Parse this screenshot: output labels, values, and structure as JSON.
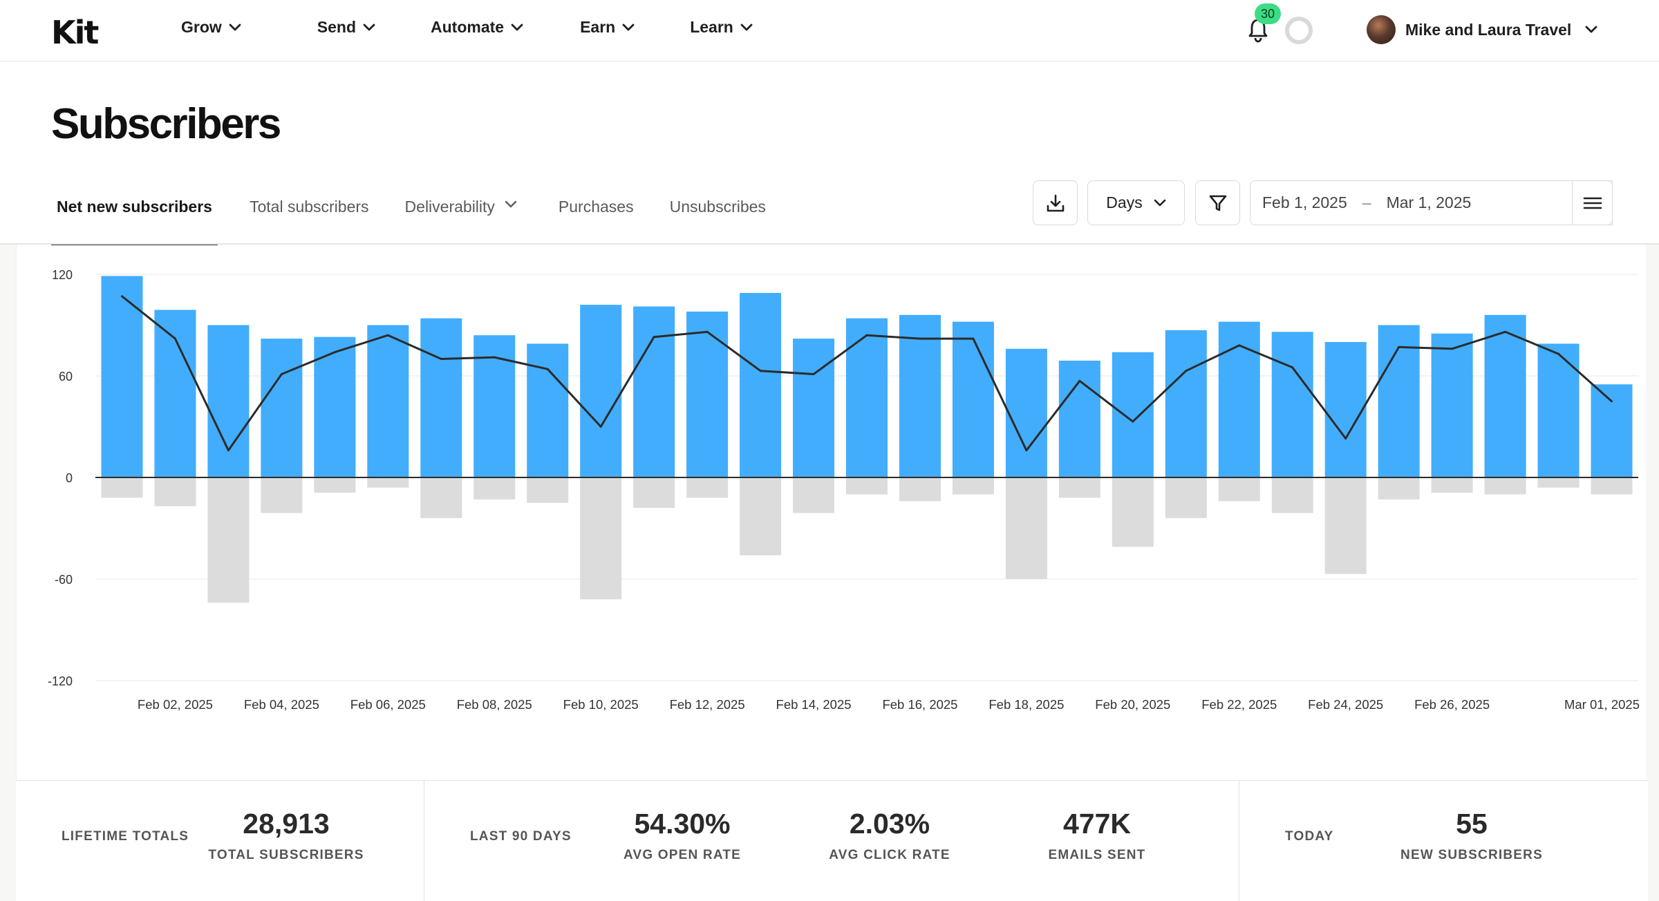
{
  "nav": {
    "logo": "Kit",
    "menu": [
      {
        "label": "Grow"
      },
      {
        "label": "Send"
      },
      {
        "label": "Automate"
      },
      {
        "label": "Earn"
      },
      {
        "label": "Learn"
      }
    ],
    "notification_count": "30",
    "account_name": "Mike and Laura Travel"
  },
  "page": {
    "title": "Subscribers",
    "tabs": [
      {
        "label": "Net new subscribers",
        "active": true
      },
      {
        "label": "Total subscribers"
      },
      {
        "label": "Deliverability",
        "dropdown": true
      },
      {
        "label": "Purchases"
      },
      {
        "label": "Unsubscribes"
      }
    ]
  },
  "toolbar": {
    "interval": "Days",
    "date_start": "Feb 1, 2025",
    "date_separator": "–",
    "date_end": "Mar 1, 2025"
  },
  "chart_data": {
    "type": "bar",
    "y_ticks": [
      120,
      60,
      0,
      -60,
      -120
    ],
    "ylim": [
      -120,
      120
    ],
    "grid": true,
    "x_tick_labels": [
      "Feb 02, 2025",
      "Feb 04, 2025",
      "Feb 06, 2025",
      "Feb 08, 2025",
      "Feb 10, 2025",
      "Feb 12, 2025",
      "Feb 14, 2025",
      "Feb 16, 2025",
      "Feb 18, 2025",
      "Feb 20, 2025",
      "Feb 22, 2025",
      "Feb 24, 2025",
      "Feb 26, 2025",
      "Mar 01, 2025"
    ],
    "categories": [
      "Feb 01, 2025",
      "Feb 02, 2025",
      "Feb 03, 2025",
      "Feb 04, 2025",
      "Feb 05, 2025",
      "Feb 06, 2025",
      "Feb 07, 2025",
      "Feb 08, 2025",
      "Feb 09, 2025",
      "Feb 10, 2025",
      "Feb 11, 2025",
      "Feb 12, 2025",
      "Feb 13, 2025",
      "Feb 14, 2025",
      "Feb 15, 2025",
      "Feb 16, 2025",
      "Feb 17, 2025",
      "Feb 18, 2025",
      "Feb 19, 2025",
      "Feb 20, 2025",
      "Feb 21, 2025",
      "Feb 22, 2025",
      "Feb 23, 2025",
      "Feb 24, 2025",
      "Feb 25, 2025",
      "Feb 26, 2025",
      "Feb 27, 2025",
      "Feb 28, 2025",
      "Mar 01, 2025"
    ],
    "series": [
      {
        "color": "#42adfc",
        "values": [
          119,
          99,
          90,
          82,
          83,
          90,
          94,
          84,
          79,
          102,
          101,
          98,
          109,
          82,
          94,
          96,
          92,
          76,
          69,
          74,
          87,
          92,
          86,
          80,
          90,
          85,
          96,
          79,
          55
        ]
      },
      {
        "color": "#dcdcdc",
        "values": [
          -12,
          -17,
          -74,
          -21,
          -9,
          -6,
          -24,
          -13,
          -15,
          -72,
          -18,
          -12,
          -46,
          -21,
          -10,
          -14,
          -10,
          -60,
          -12,
          -41,
          -24,
          -14,
          -21,
          -57,
          -13,
          -9,
          -10,
          -6,
          -10
        ]
      },
      {
        "color": "#2b2b2b",
        "values": [
          107,
          82,
          16,
          61,
          74,
          84,
          70,
          71,
          64,
          30,
          83,
          86,
          63,
          61,
          84,
          82,
          82,
          16,
          57,
          33,
          63,
          78,
          65,
          23,
          77,
          76,
          86,
          73,
          45
        ]
      }
    ]
  },
  "stats": {
    "lifetime": {
      "label": "LIFETIME TOTALS",
      "items": [
        {
          "value": "28,913",
          "label": "TOTAL SUBSCRIBERS"
        }
      ]
    },
    "last90": {
      "label": "LAST 90 DAYS",
      "items": [
        {
          "value": "54.30%",
          "label": "AVG OPEN RATE"
        },
        {
          "value": "2.03%",
          "label": "AVG CLICK RATE"
        },
        {
          "value": "477K",
          "label": "EMAILS SENT"
        }
      ]
    },
    "today": {
      "label": "TODAY",
      "items": [
        {
          "value": "55",
          "label": "NEW SUBSCRIBERS"
        }
      ]
    }
  }
}
